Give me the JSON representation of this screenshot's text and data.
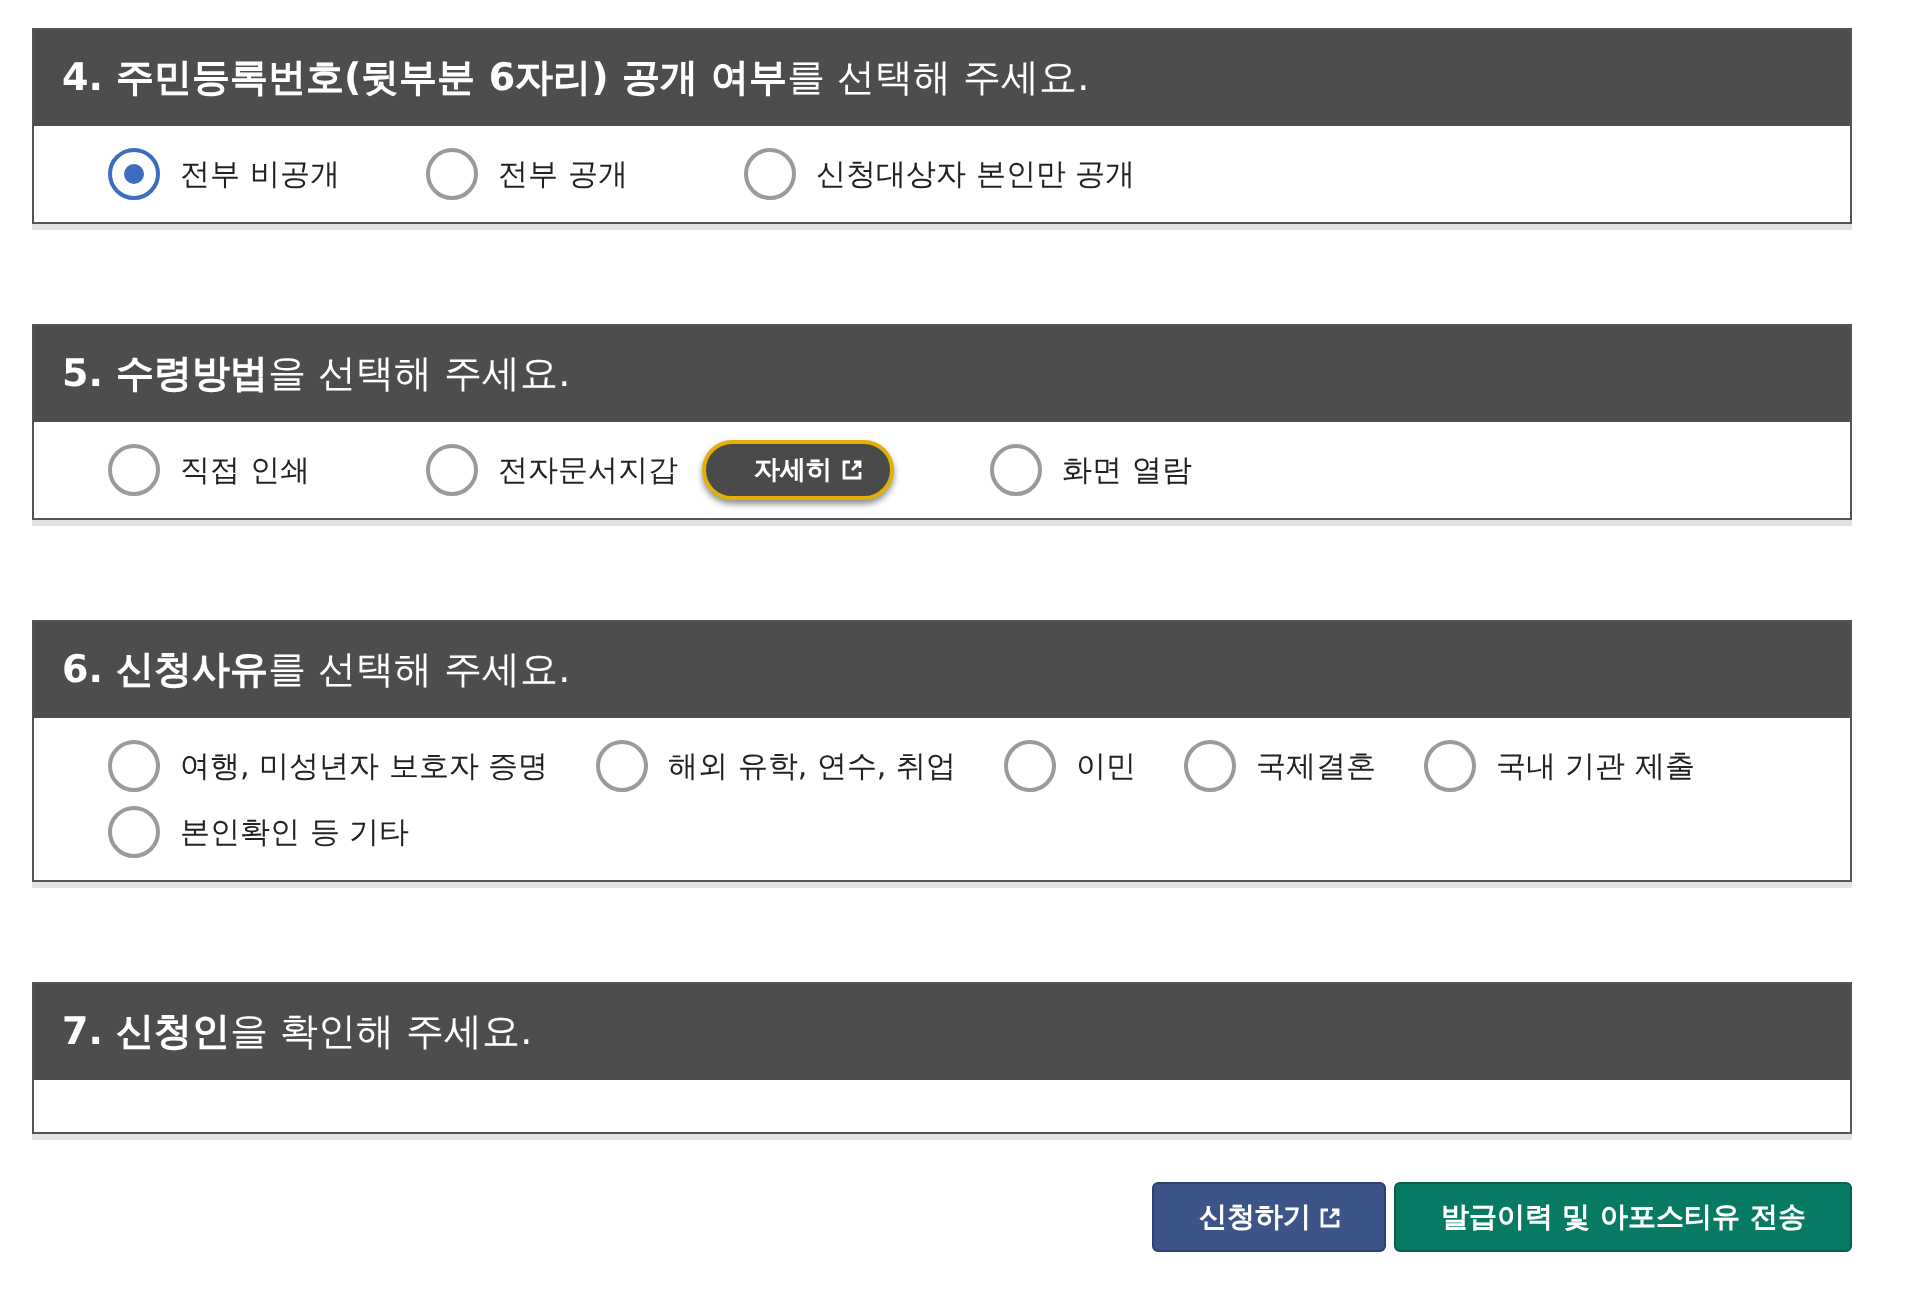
{
  "sections": [
    {
      "title": "**4. 주민등록번호(뒷부분 6자리) 공개 여부**를 선택해 주세요.",
      "options": [
        {
          "label": "전부 비공개",
          "selected": true
        },
        {
          "label": "전부 공개",
          "selected": false
        },
        {
          "label": "신청대상자 본인만 공개",
          "selected": false
        }
      ]
    },
    {
      "title": "**5. 수령방법**을 선택해 주세요.",
      "options": [
        {
          "label": "직접 인쇄",
          "selected": false
        },
        {
          "label": "전자문서지갑",
          "selected": false,
          "detail_button": "자세히"
        },
        {
          "label": "화면 열람",
          "selected": false
        }
      ]
    },
    {
      "title": "**6. 신청사유**를 선택해 주세요.",
      "options": [
        {
          "label": "여행, 미성년자 보호자 증명",
          "selected": false
        },
        {
          "label": "해외 유학, 연수, 취업",
          "selected": false
        },
        {
          "label": "이민",
          "selected": false
        },
        {
          "label": "국제결혼",
          "selected": false
        },
        {
          "label": "국내 기관 제출",
          "selected": false
        },
        {
          "label": "본인확인 등 기타",
          "selected": false
        }
      ]
    },
    {
      "title": "**7. 신청인**을 확인해 주세요."
    }
  ],
  "buttons": [
    {
      "label": "신청하기",
      "kind": "open"
    },
    {
      "label": "발급이력 및 아포스티유 전송",
      "kind": "send"
    }
  ]
}
